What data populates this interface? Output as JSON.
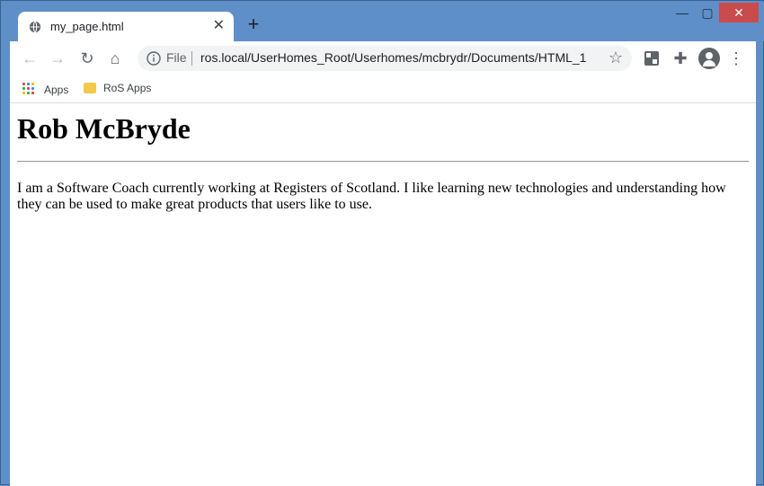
{
  "tab": {
    "title": "my_page.html",
    "close": "✕"
  },
  "newtab": "+",
  "window_controls": {
    "minimize": "—",
    "maximize": "▢",
    "close": "✕"
  },
  "address_bar": {
    "scheme_label": "File",
    "url": "ros.local/UserHomes_Root/Userhomes/mcbrydr/Documents/HTML_1..."
  },
  "bookmarks": [
    {
      "label": "Apps",
      "icon": "apps-grid-icon"
    },
    {
      "label": "RoS Apps",
      "icon": "folder-icon"
    }
  ],
  "page": {
    "heading": "Rob McBryde",
    "paragraph": "I am a Software Coach currently working at Registers of Scotland. I like learning new technologies and understanding how they can be used to make great products that users like to use."
  },
  "colors": {
    "titlebar": "#5f8fc9",
    "close_button": "#c94b4b",
    "folder": "#f2c94c"
  }
}
